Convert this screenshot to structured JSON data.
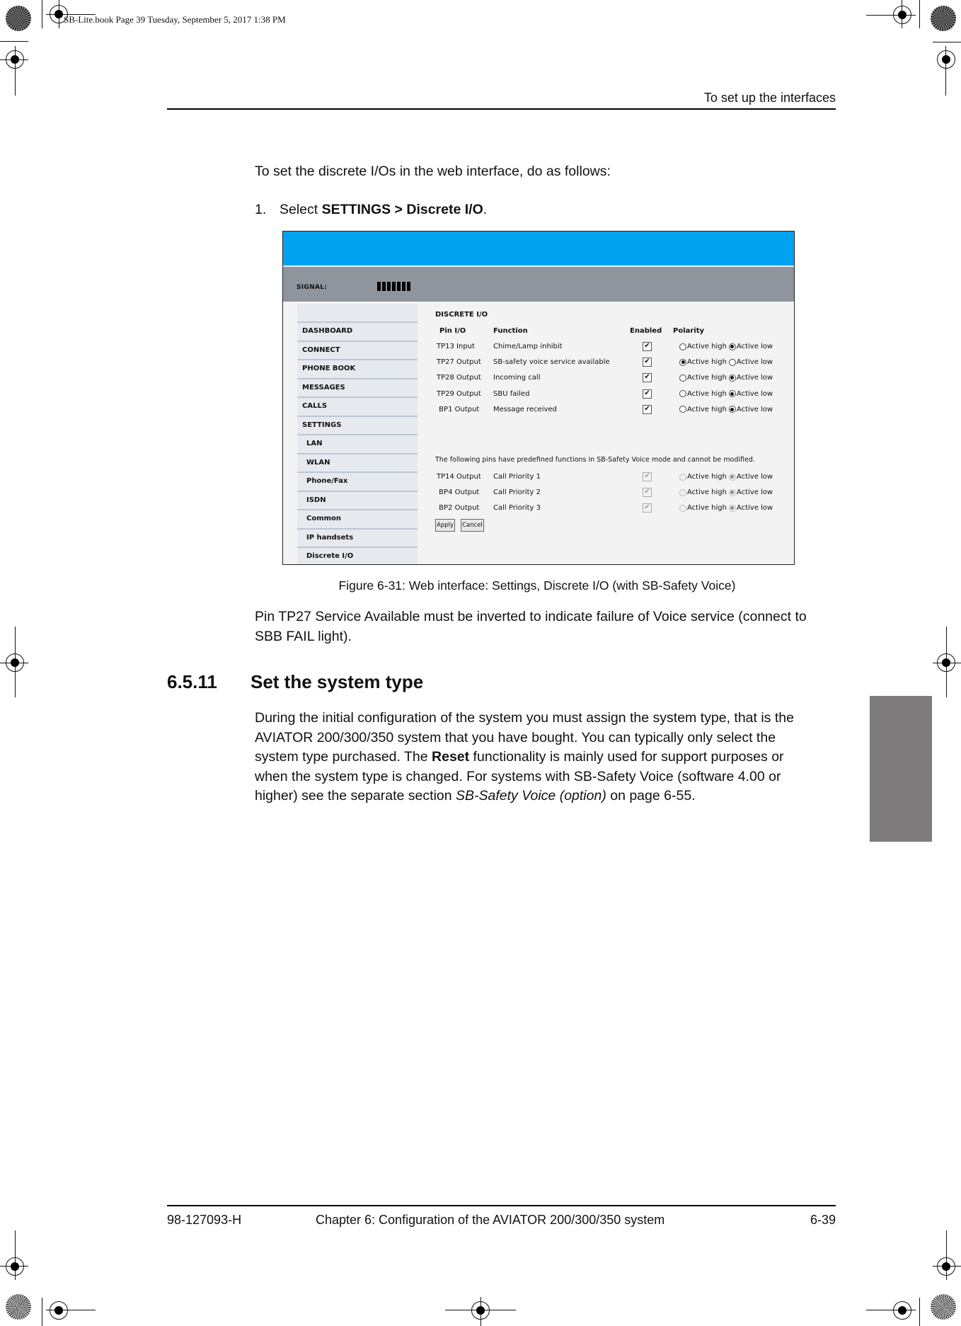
{
  "book_stamp": "SB-Lite.book  Page 39  Tuesday, September 5, 2017  1:38 PM",
  "running_head": "To set up the interfaces",
  "intro": "To set the discrete I/Os in the web interface, do as follows:",
  "step1": {
    "number": "1.",
    "prefix": "Select ",
    "bold": "SETTINGS > Discrete I/O",
    "suffix": "."
  },
  "figure": {
    "signal_label": "SIGNAL:",
    "signal_bars": 7,
    "nav": [
      {
        "label": "DASHBOARD",
        "sub": false
      },
      {
        "label": "CONNECT",
        "sub": false
      },
      {
        "label": "PHONE BOOK",
        "sub": false
      },
      {
        "label": "MESSAGES",
        "sub": false
      },
      {
        "label": "CALLS",
        "sub": false
      },
      {
        "label": "SETTINGS",
        "sub": false
      },
      {
        "label": "LAN",
        "sub": true
      },
      {
        "label": "WLAN",
        "sub": true
      },
      {
        "label": "Phone/Fax",
        "sub": true
      },
      {
        "label": "ISDN",
        "sub": true
      },
      {
        "label": "Common",
        "sub": true
      },
      {
        "label": "IP handsets",
        "sub": true
      },
      {
        "label": "Discrete I/O",
        "sub": true
      }
    ],
    "title": "DISCRETE I/O",
    "headers": {
      "pin_io": "Pin  I/O",
      "function": "Function",
      "enabled": "Enabled",
      "polarity": "Polarity"
    },
    "polarity_options": {
      "high": "Active high",
      "low": "Active low"
    },
    "rows": [
      {
        "pin": "TP13",
        "io": "Input",
        "function": "Chime/Lamp inhibit",
        "enabled": true,
        "polarity": "low",
        "editable": true
      },
      {
        "pin": "TP27",
        "io": "Output",
        "function": "SB-safety voice service available",
        "enabled": true,
        "polarity": "high",
        "editable": true
      },
      {
        "pin": "TP28",
        "io": "Output",
        "function": "Incoming call",
        "enabled": true,
        "polarity": "low",
        "editable": true
      },
      {
        "pin": "TP29",
        "io": "Output",
        "function": "SBU failed",
        "enabled": true,
        "polarity": "low",
        "editable": true
      },
      {
        "pin": "BP1",
        "io": "Output",
        "function": "Message received",
        "enabled": true,
        "polarity": "low",
        "editable": true
      }
    ],
    "note": "The following pins have predefined functions in SB-Safety Voice mode and cannot be modified.",
    "fixed_rows": [
      {
        "pin": "TP14",
        "io": "Output",
        "function": "Call Priority 1",
        "enabled": true,
        "polarity": "low",
        "editable": false
      },
      {
        "pin": "BP4",
        "io": "Output",
        "function": "Call Priority 2",
        "enabled": true,
        "polarity": "low",
        "editable": false
      },
      {
        "pin": "BP2",
        "io": "Output",
        "function": "Call Priority 3",
        "enabled": true,
        "polarity": "low",
        "editable": false
      }
    ],
    "apply_label": "Apply",
    "cancel_label": "Cancel"
  },
  "caption": "Figure 6-31: Web interface: Settings, Discrete I/O (with SB-Safety Voice)",
  "pin_note": {
    "line1": "Pin TP27 Service Available must be inverted to indicate failure of Voice service (connect to",
    "line2": "SBB FAIL light)."
  },
  "section": {
    "number": "6.5.11",
    "title": "Set the system type"
  },
  "section_body": {
    "line1": "During the initial configuration of the system you must assign the system type, that is the",
    "line2": "AVIATOR 200/300/350 system that you have bought. You can typically only select the",
    "line3_pre": "system type purchased. The ",
    "line3_bold": "Reset",
    "line3_post": " functionality is mainly used for support purposes or",
    "line4": "when the system type is changed. For systems with SB-Safety Voice (software 4.00 or",
    "line5_pre": "higher) see the separate section ",
    "line5_italic": "SB-Safety Voice (option)",
    "line5_post": " on page 6-55."
  },
  "footer": {
    "doc_number": "98-127093-H",
    "chapter": "Chapter 6:  Configuration of the AVIATOR 200/300/350 system",
    "page": "6-39"
  },
  "colors": {
    "banner": "#00a3f0",
    "signal_bar": "#8e959d",
    "thumb_tab": "#7d7b7b"
  }
}
